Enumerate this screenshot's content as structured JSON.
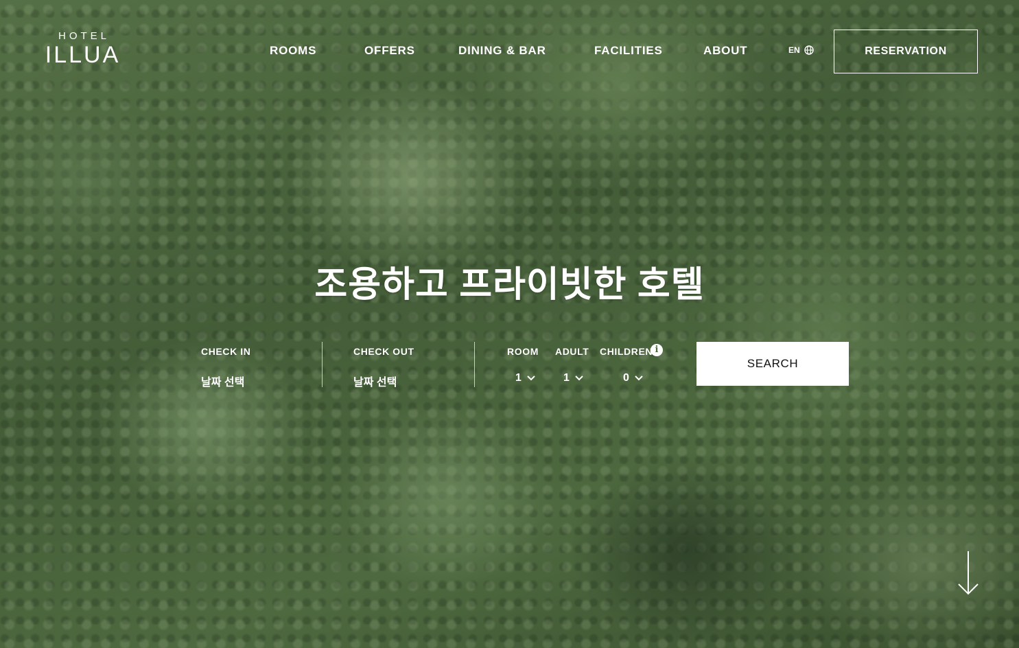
{
  "brand": {
    "top": "HOTEL",
    "name": "ILLUA"
  },
  "nav": {
    "items": [
      {
        "label": "ROOMS"
      },
      {
        "label": "OFFERS"
      },
      {
        "label": "DINING & BAR"
      },
      {
        "label": "FACILITIES"
      },
      {
        "label": "ABOUT"
      }
    ]
  },
  "language": {
    "label": "EN",
    "icon": "globe-icon"
  },
  "reservation": {
    "label": "RESERVATION"
  },
  "hero": {
    "title": "조용하고 프라이빗한 호텔"
  },
  "booking": {
    "check_in": {
      "label": "CHECK IN",
      "value": "날짜 선택"
    },
    "check_out": {
      "label": "CHECK OUT",
      "value": "날짜 선택"
    },
    "room": {
      "label": "ROOM",
      "value": "1"
    },
    "adult": {
      "label": "ADULT",
      "value": "1"
    },
    "children": {
      "label": "CHILDREN",
      "value": "0",
      "info_icon": "i"
    },
    "search_label": "SEARCH"
  },
  "scroll": {
    "icon": "arrow-down-icon"
  },
  "colors": {
    "text": "#ffffff",
    "button_bg": "#ffffff",
    "button_text": "#111111",
    "background": "#4e6840"
  }
}
